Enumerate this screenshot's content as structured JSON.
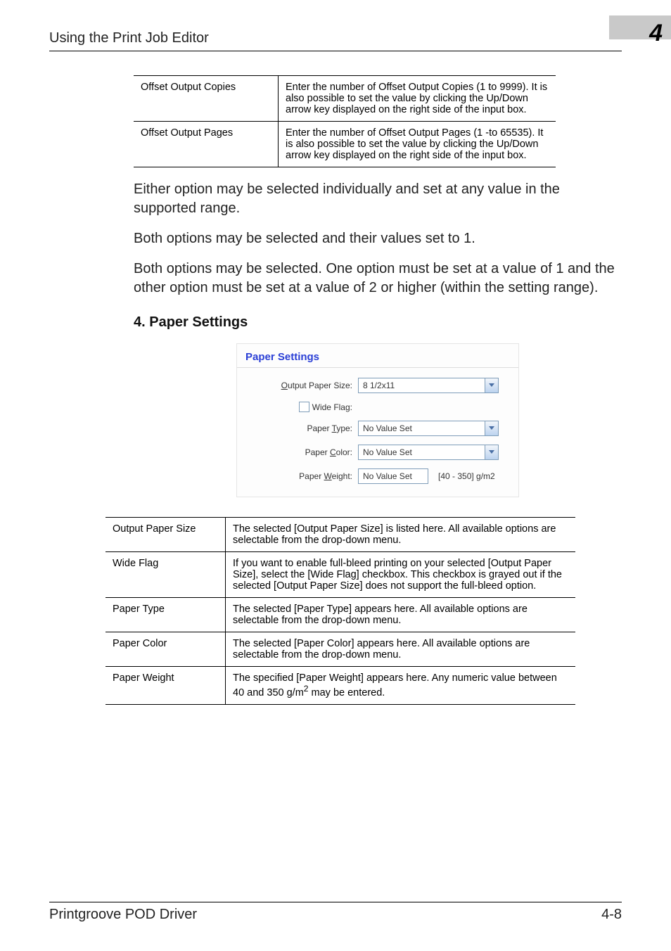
{
  "header": {
    "title": "Using the Print Job Editor",
    "chapter": "4"
  },
  "offset_table": {
    "rows": [
      {
        "label": "Offset Output Copies",
        "desc": "Enter the number of Offset Output Copies (1 to 9999). It is also possible to set the value by clicking the Up/Down arrow key displayed on the right side of the input box."
      },
      {
        "label": "Offset Output Pages",
        "desc": "Enter the number of Offset Output Pages (1 -to 65535). It is also possible to set the value by clicking the Up/Down arrow key displayed on the right side of the input box."
      }
    ]
  },
  "paragraphs": {
    "p1": "Either option may be selected individually and set at any value in the supported range.",
    "p2": "Both options may be selected and their values set to 1.",
    "p3": "Both options may be selected. One option must be set at a value of 1 and the other option must be set at a value of 2 or higher (within the setting range)."
  },
  "section_heading": "4. Paper Settings",
  "panel": {
    "title": "Paper Settings",
    "output_paper_size": {
      "prefix": "O",
      "rest": "utput Paper Size:",
      "value": "8 1/2x11"
    },
    "wide_flag": {
      "label": "Wide Flag:"
    },
    "paper_type": {
      "label_prefix": "Paper ",
      "underline": "T",
      "label_suffix": "ype:",
      "value": "No Value Set"
    },
    "paper_color": {
      "label_prefix": "Paper ",
      "underline": "C",
      "label_suffix": "olor:",
      "value": "No Value Set"
    },
    "paper_weight": {
      "label_prefix": "Paper ",
      "underline": "W",
      "label_suffix": "eight:",
      "value": "No Value Set",
      "unit": "[40 - 350] g/m2"
    }
  },
  "settings_table": {
    "rows": [
      {
        "label": "Output Paper Size",
        "desc": "The selected [Output Paper Size] is listed here. All available options are selectable from the drop-down menu."
      },
      {
        "label": "Wide Flag",
        "desc": "If you want to enable full-bleed printing on your selected [Output Paper Size], select the [Wide Flag] checkbox. This checkbox is grayed out if the selected [Output Paper Size] does not support the full-bleed option."
      },
      {
        "label": "Paper Type",
        "desc": "The selected [Paper Type] appears here. All available options are selectable from the drop-down menu."
      },
      {
        "label": "Paper Color",
        "desc": "The selected [Paper Color] appears here. All available options are selectable from the drop-down menu."
      },
      {
        "label": "Paper Weight",
        "desc_prefix": "The specified [Paper Weight] appears here. Any numeric value between 40 and 350 g/m",
        "desc_sup": "2",
        "desc_suffix": " may be entered."
      }
    ]
  },
  "footer": {
    "left": "Printgroove POD Driver",
    "right": "4-8"
  }
}
